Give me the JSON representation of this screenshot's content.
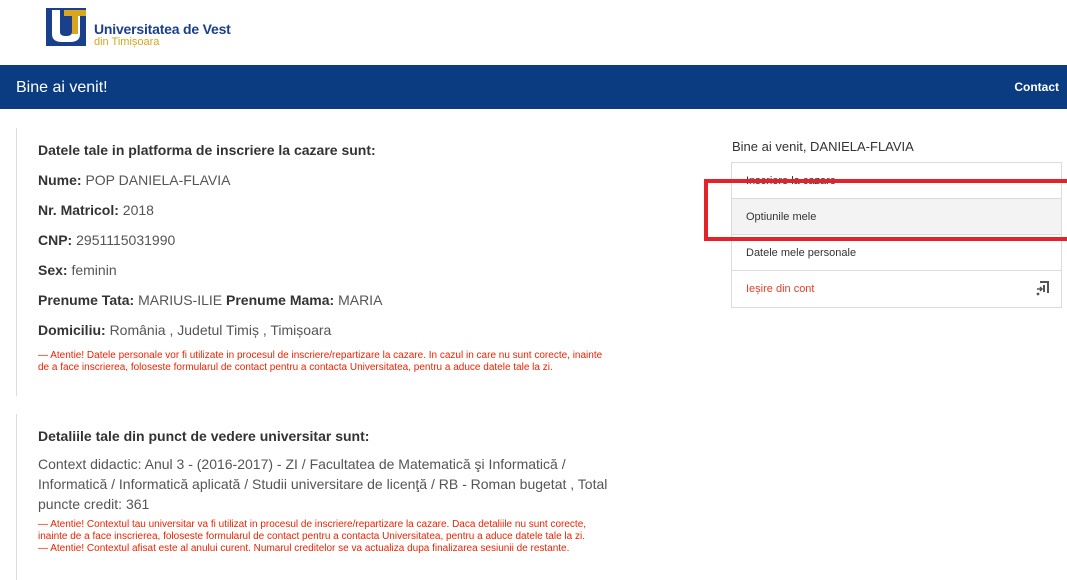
{
  "logo": {
    "line1": "Universitatea de Vest",
    "line2": "din Timișoara",
    "colors": {
      "blue": "#1a3f8b",
      "gold": "#d8a520"
    }
  },
  "topbar": {
    "title": "Bine ai venit!",
    "contact": "Contact",
    "bg": "#0b3c82"
  },
  "personal": {
    "heading": "Datele tale in platforma de inscriere la cazare sunt:",
    "nume_label": "Nume:",
    "nume": "POP DANIELA-FLAVIA",
    "matricol_label": "Nr. Matricol:",
    "matricol": "2018",
    "cnp_label": "CNP:",
    "cnp": "2951115031990",
    "sex_label": "Sex:",
    "sex": "feminin",
    "tata_label": "Prenume Tata:",
    "tata": "MARIUS-ILIE",
    "mama_label": "Prenume Mama:",
    "mama": "MARIA",
    "domiciliu_label": "Domiciliu:",
    "domiciliu": "România , Judetul Timiș , Timișoara",
    "warning_l1": "— Atentie! Datele personale vor fi utilizate in procesul de inscriere/repartizare la cazare. In cazul in care nu sunt corecte, inainte",
    "warning_l2": "de a face inscrierea, foloseste formularul de contact pentru a contacta Universitatea, pentru a aduce datele tale la zi."
  },
  "university": {
    "heading": "Detaliile tale din punct de vedere universitar sunt:",
    "context_l1": "Context didactic: Anul 3 - (2016-2017) - ZI / Facultatea de Matematică şi Informatică /",
    "context_l2": "Informatică / Informatică aplicată / Studii universitare de licenţă / RB - Roman bugetat , Total",
    "context_l3": "puncte credit: 361",
    "warning_l1": "— Atentie! Contextul tau universitar va fi utilizat in procesul de inscriere/repartizare la cazare. Daca detaliile nu sunt corecte,",
    "warning_l2": "inainte de a face inscrierea, foloseste formularul de contact pentru a contacta Universitatea, pentru a aduce datele tale la zi.",
    "warning_l3": "— Atentie! Contextul afisat este al anului curent. Numarul creditelor se va actualiza dupa finalizarea sesiunii de restante."
  },
  "sidebar": {
    "greeting": "Bine ai venit, DANIELA-FLAVIA",
    "items": [
      {
        "label": "Inscriere la cazare"
      },
      {
        "label": "Optiunile mele"
      },
      {
        "label": "Datele mele personale"
      },
      {
        "label": "Ieșire din cont",
        "icon": "logout-icon"
      }
    ]
  },
  "colors": {
    "warning": "#ee2200",
    "highlight": "#e32229",
    "logout": "#e6402b"
  }
}
